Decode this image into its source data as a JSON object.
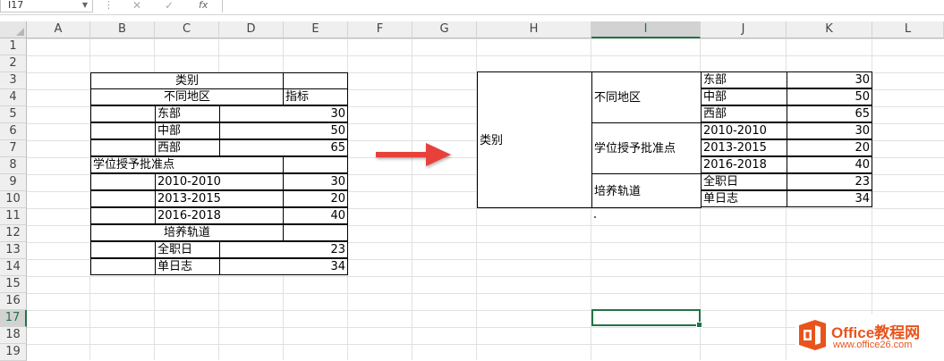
{
  "formula_bar": {
    "name_box": "I17",
    "formula": ""
  },
  "columns": [
    "A",
    "B",
    "C",
    "D",
    "E",
    "F",
    "G",
    "H",
    "I",
    "J",
    "K",
    "L"
  ],
  "rows": [
    "1",
    "2",
    "3",
    "4",
    "5",
    "6",
    "7",
    "8",
    "9",
    "10",
    "11",
    "12",
    "13",
    "14",
    "15",
    "16",
    "17",
    "18",
    "19"
  ],
  "left_table": {
    "r3_title": "类别",
    "r4_region": "不同地区",
    "r4_metric": "指标",
    "r5_label": "东部",
    "r5_value": "30",
    "r6_label": "中部",
    "r6_value": "50",
    "r7_label": "西部",
    "r7_value": "65",
    "r8_label": "学位授予批准点",
    "r9_label": "2010-2010",
    "r9_value": "30",
    "r10_label": "2013-2015",
    "r10_value": "20",
    "r11_label": "2016-2018",
    "r11_value": "40",
    "r12_label": "培养轨道",
    "r13_label": "全职日",
    "r13_value": "23",
    "r14_label": "单日志",
    "r14_value": "34"
  },
  "right_table": {
    "category": "类别",
    "group1": "不同地区",
    "group2": "学位授予批准点",
    "group3": "培养轨道",
    "items": [
      {
        "label": "东部",
        "value": "30"
      },
      {
        "label": "中部",
        "value": "50"
      },
      {
        "label": "西部",
        "value": "65"
      },
      {
        "label": "2010-2010",
        "value": "30"
      },
      {
        "label": "2013-2015",
        "value": "20"
      },
      {
        "label": "2016-2018",
        "value": "40"
      },
      {
        "label": "全职日",
        "value": "23"
      },
      {
        "label": "单日志",
        "value": "34"
      }
    ]
  },
  "logo": {
    "title": "Office教程网",
    "url": "www.office26.com"
  },
  "colors": {
    "excel_green": "#217346",
    "arrow_red": "#e8403a",
    "logo_orange": "#e8541c"
  }
}
